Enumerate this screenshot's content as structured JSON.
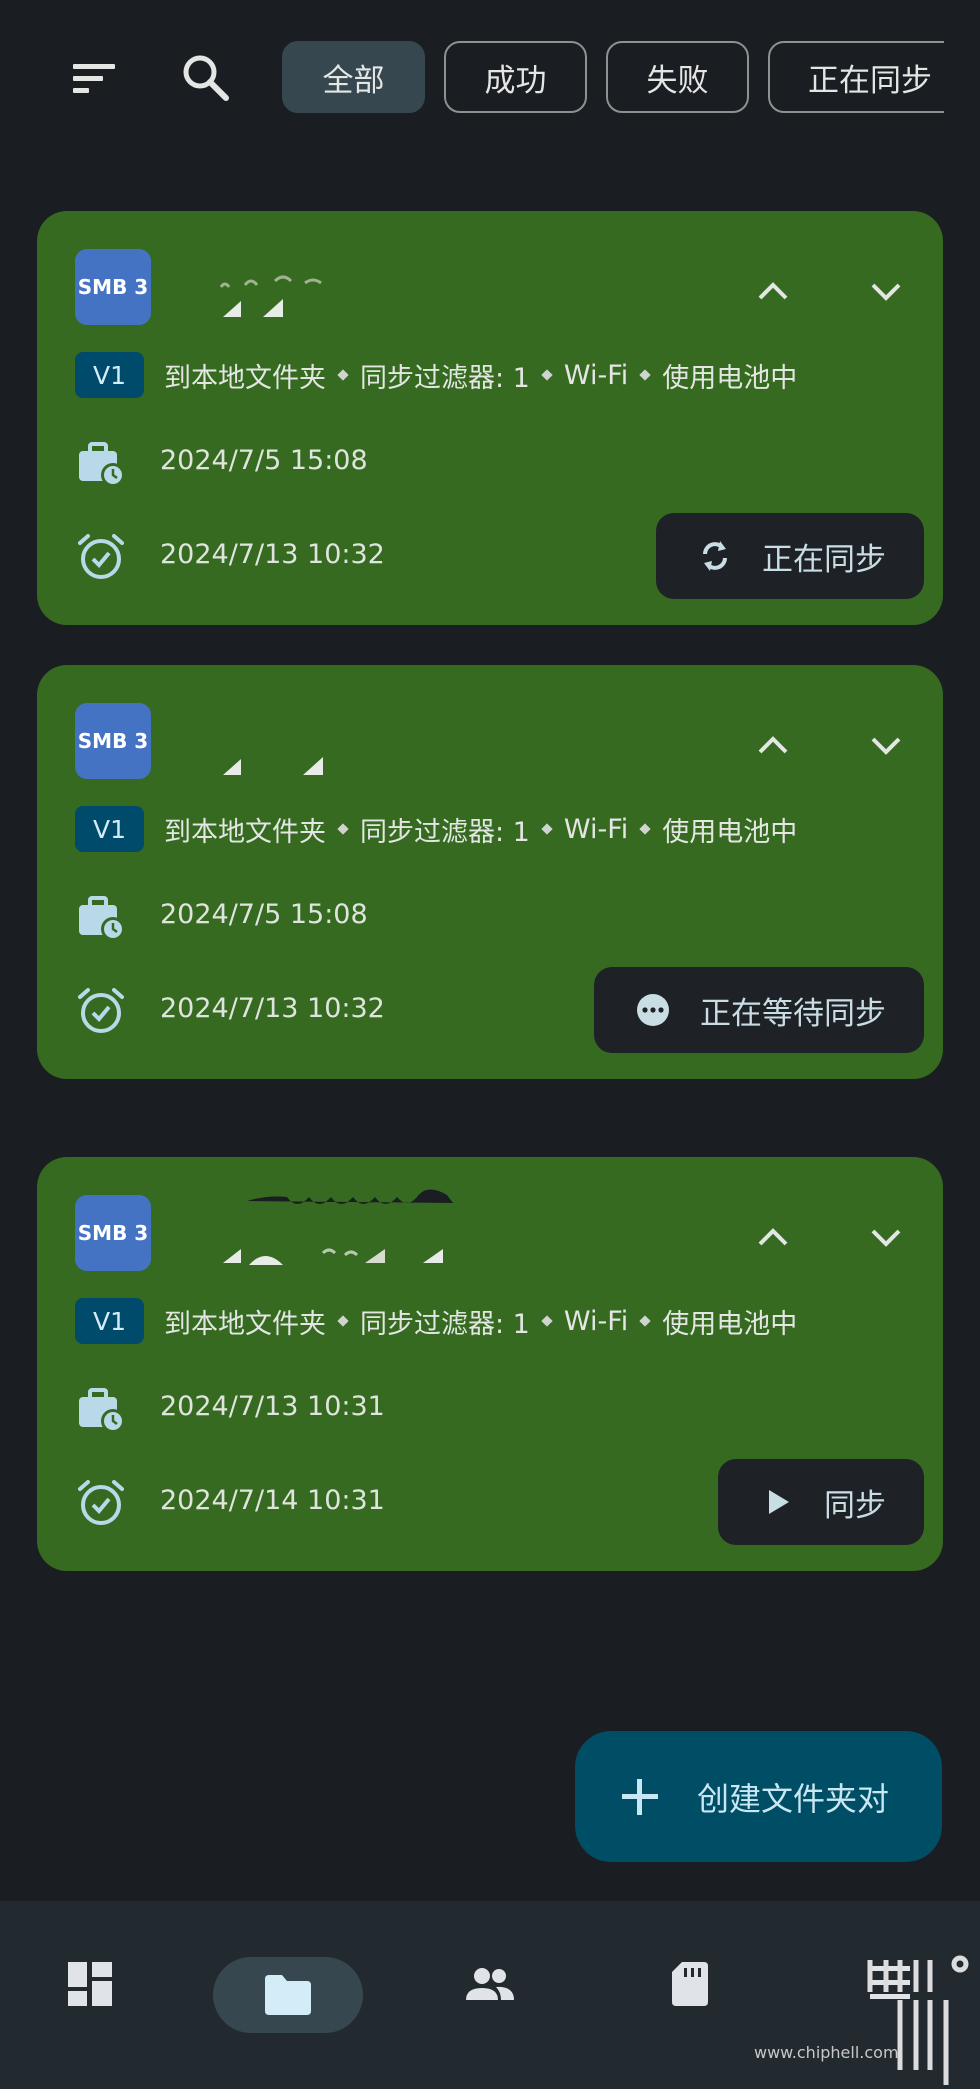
{
  "filters": {
    "all": "全部",
    "success": "成功",
    "failed": "失败",
    "syncing": "正在同步"
  },
  "cards": [
    {
      "protocol": "SMB 3",
      "version": "V1",
      "meta": [
        "到本地文件夹",
        "同步过滤器: 1",
        "Wi-Fi",
        "使用电池中"
      ],
      "last_sync": "2024/7/5 15:08",
      "next_sync": "2024/7/13 10:32",
      "action_label": "正在同步",
      "action_icon": "sync-icon"
    },
    {
      "protocol": "SMB 3",
      "version": "V1",
      "meta": [
        "到本地文件夹",
        "同步过滤器: 1",
        "Wi-Fi",
        "使用电池中"
      ],
      "last_sync": "2024/7/5 15:08",
      "next_sync": "2024/7/13 10:32",
      "action_label": "正在等待同步",
      "action_icon": "more-horizontal-circle-icon"
    },
    {
      "protocol": "SMB 3",
      "version": "V1",
      "meta": [
        "到本地文件夹",
        "同步过滤器: 1",
        "Wi-Fi",
        "使用电池中"
      ],
      "last_sync": "2024/7/13 10:31",
      "next_sync": "2024/7/14 10:31",
      "action_label": "同步",
      "action_icon": "play-icon"
    }
  ],
  "fab": {
    "label": "创建文件夹对"
  },
  "watermark": {
    "text": "www.chiphell.com"
  },
  "colors": {
    "background": "#1a1d21",
    "card": "#356a20",
    "badge": "#4573c4",
    "chip_active": "#37474f",
    "fab": "#004d66"
  }
}
